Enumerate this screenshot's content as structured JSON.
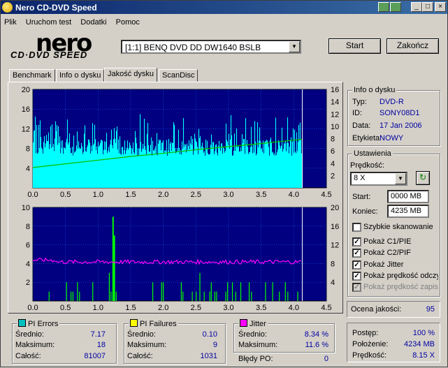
{
  "window": {
    "title": "Nero CD-DVD Speed"
  },
  "menu": [
    "Plik",
    "Uruchom test",
    "Dodatki",
    "Pomoc"
  ],
  "logo": {
    "top": "nero",
    "bottom": "CD·DVD SPEED"
  },
  "drive": {
    "selected": "[1:1]  BENQ DVD DD DW1640 BSLB"
  },
  "buttons": {
    "start": "Start",
    "end": "Zakończ"
  },
  "tabs": [
    "Benchmark",
    "Info o dysku",
    "Jakość dysku",
    "ScanDisc"
  ],
  "disc_info": {
    "title": "Info o dysku",
    "rows": [
      {
        "label": "Typ:",
        "value": "DVD-R"
      },
      {
        "label": "ID:",
        "value": "SONY08D1"
      },
      {
        "label": "Data:",
        "value": "17 Jan 2006"
      },
      {
        "label": "Etykieta:",
        "value": "NOWY"
      }
    ]
  },
  "settings": {
    "title": "Ustawienia",
    "speed_label": "Prędkość:",
    "speed_value": "8 X",
    "start_label": "Start:",
    "start_value": "0000 MB",
    "end_label": "Koniec:",
    "end_value": "4235 MB",
    "checkboxes": [
      {
        "label": "Szybkie skanowanie",
        "checked": false,
        "disabled": false
      },
      {
        "label": "Pokaż C1/PIE",
        "checked": true,
        "disabled": false
      },
      {
        "label": "Pokaż C2/PIF",
        "checked": true,
        "disabled": false
      },
      {
        "label": "Pokaż Jitter",
        "checked": true,
        "disabled": false
      },
      {
        "label": "Pokaż prędkość odczytu",
        "checked": true,
        "disabled": false
      },
      {
        "label": "Pokaż prędkość zapisu",
        "checked": true,
        "disabled": true
      }
    ]
  },
  "quality": {
    "label": "Ocena jakości:",
    "value": "95"
  },
  "pi_errors": {
    "title": "PI Errors",
    "color": "#00c0c0",
    "rows": [
      {
        "label": "Średnio:",
        "value": "7.17"
      },
      {
        "label": "Maksimum:",
        "value": "18"
      },
      {
        "label": "Całość:",
        "value": "81007"
      }
    ]
  },
  "pi_failures": {
    "title": "PI Failures",
    "color": "#ffff00",
    "rows": [
      {
        "label": "Średnio:",
        "value": "0.10"
      },
      {
        "label": "Maksimum:",
        "value": "9"
      },
      {
        "label": "Całość:",
        "value": "1031"
      }
    ]
  },
  "jitter": {
    "title": "Jitter",
    "color": "#ff00ff",
    "rows": [
      {
        "label": "Średnio:",
        "value": "8.34 %"
      },
      {
        "label": "Maksimum:",
        "value": "11.6 %"
      }
    ],
    "po_label": "Błędy PO:",
    "po_value": "0"
  },
  "progress": {
    "rows": [
      {
        "label": "Postęp:",
        "value": "100 %"
      },
      {
        "label": "Położenie:",
        "value": "4234 MB"
      },
      {
        "label": "Prędkość:",
        "value": "8.15 X"
      }
    ]
  },
  "chart_top": {
    "y_left": [
      "20",
      "16",
      "12",
      "8",
      "4"
    ],
    "y_right": [
      "16",
      "14",
      "12",
      "10",
      "8",
      "6",
      "4",
      "2"
    ],
    "x": [
      "0.0",
      "0.5",
      "1.0",
      "1.5",
      "2.0",
      "2.5",
      "3.0",
      "3.5",
      "4.0",
      "4.5"
    ]
  },
  "chart_bottom": {
    "y_left": [
      "10",
      "8",
      "6",
      "4",
      "2"
    ],
    "y_right": [
      "20",
      "16",
      "12",
      "8",
      "4"
    ],
    "x": [
      "0.0",
      "0.5",
      "1.0",
      "1.5",
      "2.0",
      "2.5",
      "3.0",
      "3.5",
      "4.0",
      "4.5"
    ]
  },
  "chart_data": [
    {
      "type": "area",
      "title": "PI Errors",
      "x_range": [
        0,
        4.5
      ],
      "y_range": [
        0,
        20
      ],
      "y2_range": [
        0,
        16
      ],
      "series": [
        {
          "name": "PI Errors",
          "color": "#00ffff",
          "avg": 7.17,
          "max": 18,
          "end_x": 4.13
        },
        {
          "name": "Prędkość",
          "color": "#00c000",
          "x": [
            0.0,
            0.5,
            1.0,
            1.5,
            2.0,
            2.5,
            3.0,
            3.5,
            4.13
          ],
          "y": [
            3.3,
            3.9,
            4.5,
            5.1,
            5.6,
            6.2,
            6.7,
            7.2,
            7.9
          ]
        }
      ]
    },
    {
      "type": "bar",
      "title": "PI Failures / Jitter",
      "x_range": [
        0,
        4.5
      ],
      "y_range": [
        0,
        10
      ],
      "y2_range": [
        0,
        20
      ],
      "series": [
        {
          "name": "PI Failures",
          "color": "#00ff00",
          "max": 9,
          "spikes": [
            {
              "x": 1.23,
              "y": 9
            },
            {
              "x": 1.25,
              "y": 7
            }
          ]
        },
        {
          "name": "Jitter",
          "color": "#ff00ff",
          "avg": 8.34,
          "max": 11.6
        }
      ]
    }
  ]
}
